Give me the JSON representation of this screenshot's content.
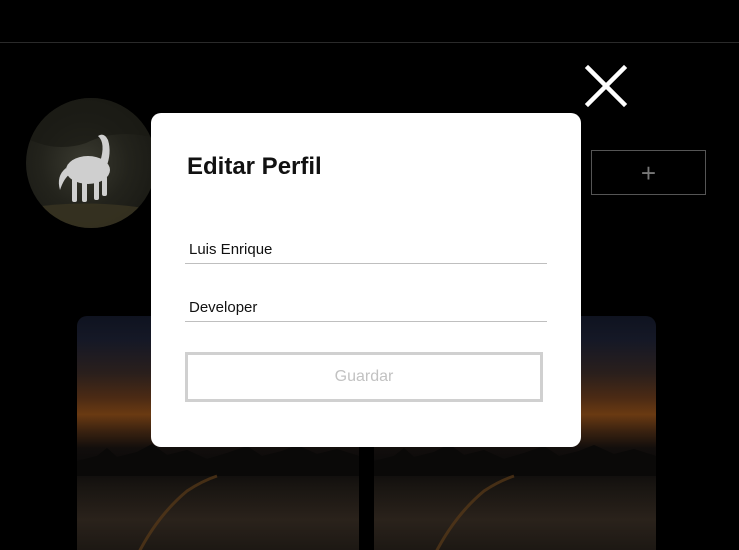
{
  "modal": {
    "title": "Editar Perfil",
    "name_value": "Luis Enrique",
    "role_value": "Developer",
    "save_label": "Guardar"
  },
  "profile": {
    "add_label": "+"
  },
  "icons": {
    "close": "close-icon",
    "add": "plus-icon"
  }
}
